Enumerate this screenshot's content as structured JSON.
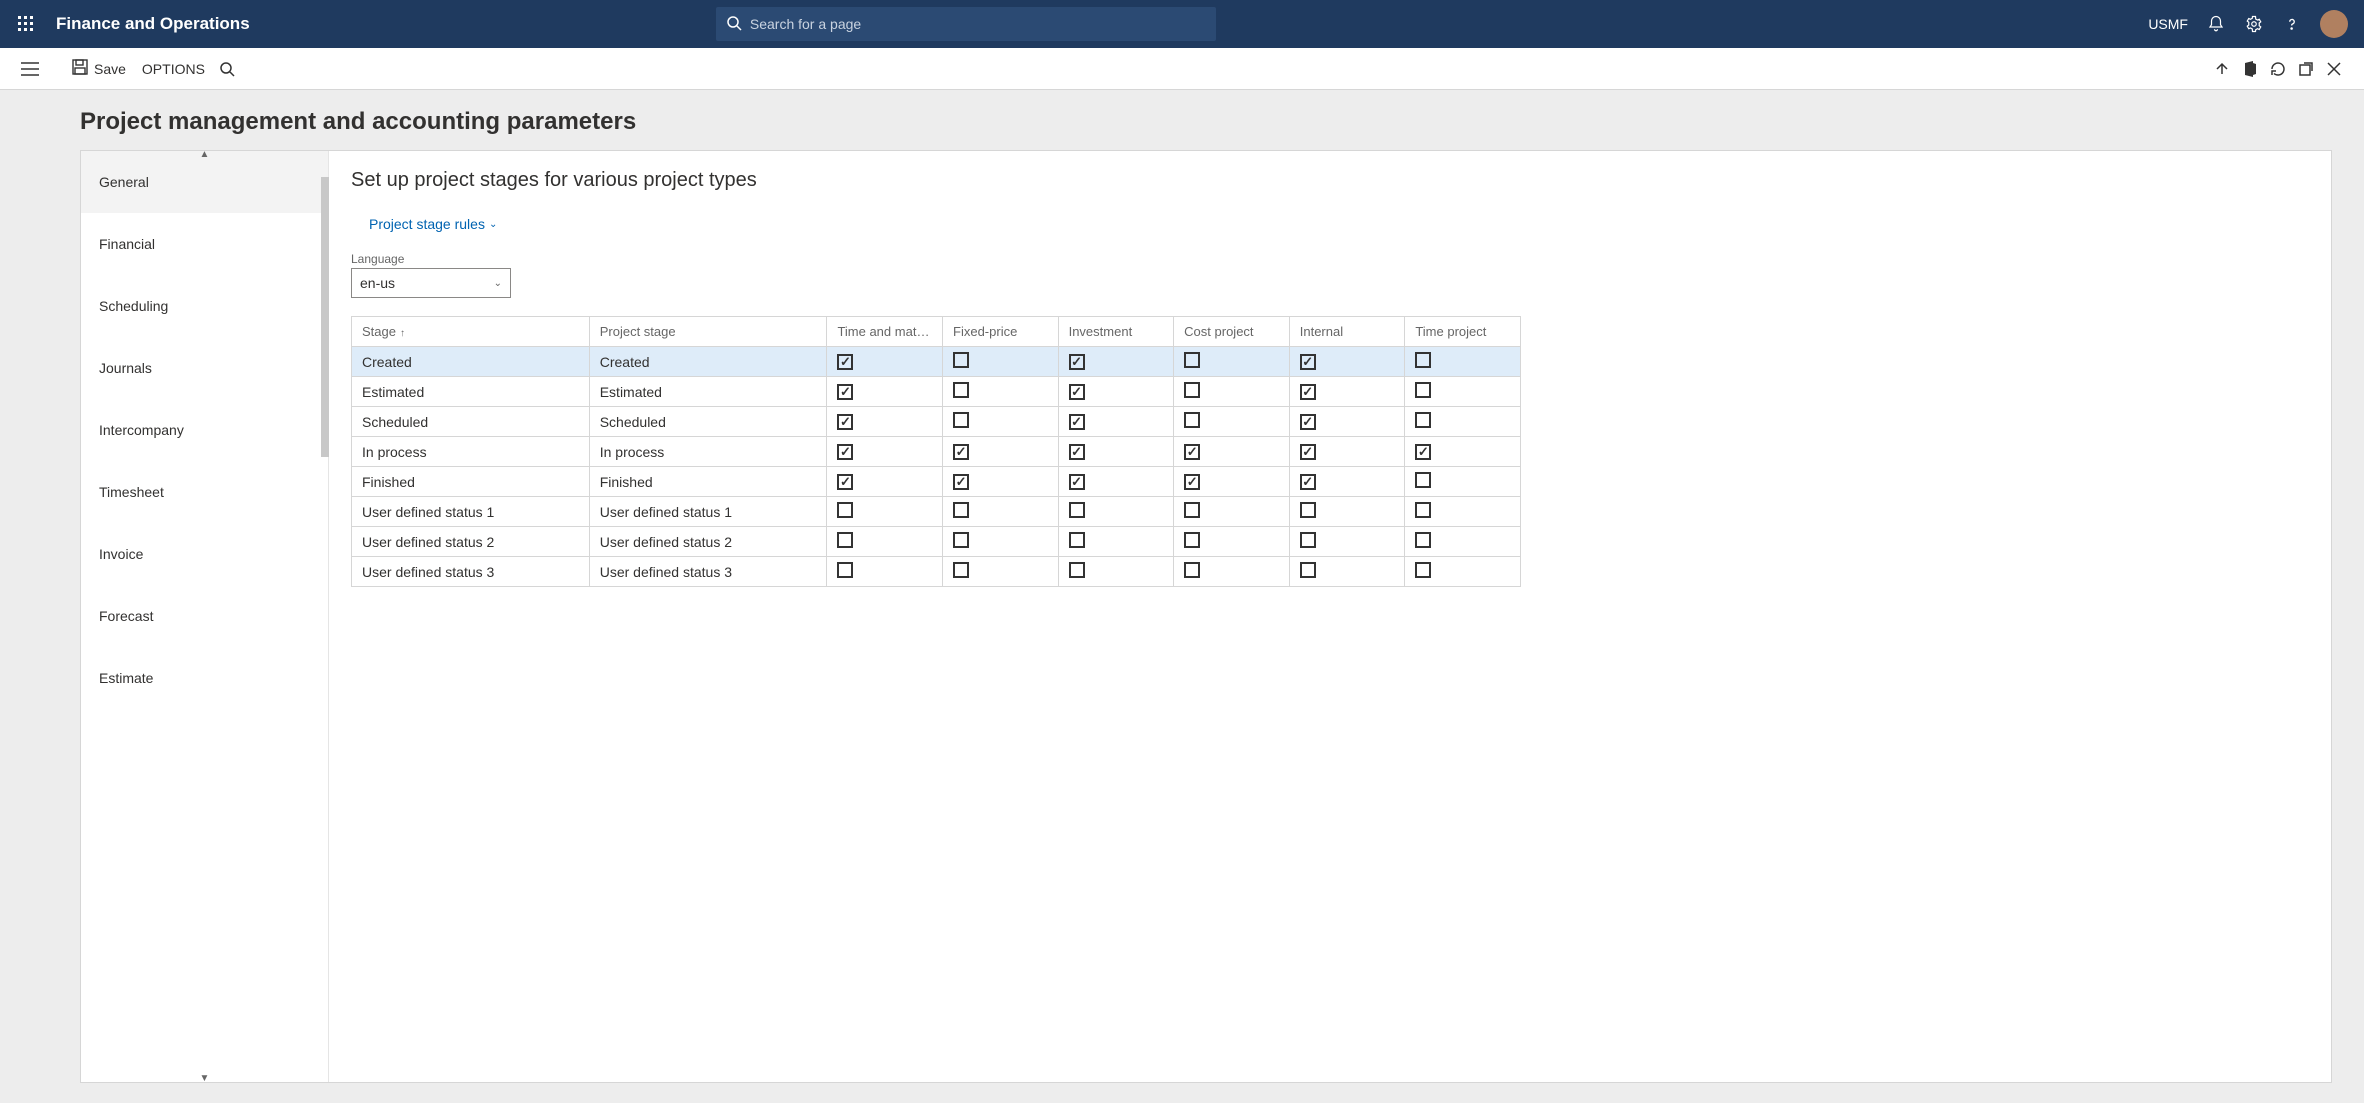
{
  "header": {
    "app_title": "Finance and Operations",
    "search_placeholder": "Search for a page",
    "company_code": "USMF"
  },
  "actionbar": {
    "save_label": "Save",
    "options_label": "OPTIONS"
  },
  "page": {
    "title": "Project management and accounting parameters"
  },
  "sidenav": {
    "items": [
      {
        "label": "General"
      },
      {
        "label": "Financial"
      },
      {
        "label": "Scheduling"
      },
      {
        "label": "Journals"
      },
      {
        "label": "Intercompany"
      },
      {
        "label": "Timesheet"
      },
      {
        "label": "Invoice"
      },
      {
        "label": "Forecast"
      },
      {
        "label": "Estimate"
      }
    ],
    "active_index": 0
  },
  "main": {
    "section_title": "Set up project stages for various project types",
    "rules_link": "Project stage rules",
    "language_label": "Language",
    "language_value": "en-us",
    "columns": {
      "stage": "Stage",
      "project_stage": "Project stage",
      "time_and_material": "Time and materi...",
      "fixed_price": "Fixed-price",
      "investment": "Investment",
      "cost_project": "Cost project",
      "internal": "Internal",
      "time_project": "Time project"
    },
    "rows": [
      {
        "stage": "Created",
        "project_stage": "Created",
        "tm": true,
        "fp": false,
        "inv": true,
        "cp": false,
        "int": true,
        "tp": false,
        "selected": true
      },
      {
        "stage": "Estimated",
        "project_stage": "Estimated",
        "tm": true,
        "fp": false,
        "inv": true,
        "cp": false,
        "int": true,
        "tp": false
      },
      {
        "stage": "Scheduled",
        "project_stage": "Scheduled",
        "tm": true,
        "fp": false,
        "inv": true,
        "cp": false,
        "int": true,
        "tp": false
      },
      {
        "stage": "In process",
        "project_stage": "In process",
        "tm": true,
        "fp": true,
        "inv": true,
        "cp": true,
        "int": true,
        "tp": true
      },
      {
        "stage": "Finished",
        "project_stage": "Finished",
        "tm": true,
        "fp": true,
        "inv": true,
        "cp": true,
        "int": true,
        "tp": false
      },
      {
        "stage": "User defined status 1",
        "project_stage": "User defined status 1",
        "tm": false,
        "fp": false,
        "inv": false,
        "cp": false,
        "int": false,
        "tp": false
      },
      {
        "stage": "User defined status 2",
        "project_stage": "User defined status 2",
        "tm": false,
        "fp": false,
        "inv": false,
        "cp": false,
        "int": false,
        "tp": false
      },
      {
        "stage": "User defined status 3",
        "project_stage": "User defined status 3",
        "tm": false,
        "fp": false,
        "inv": false,
        "cp": false,
        "int": false,
        "tp": false
      }
    ]
  }
}
